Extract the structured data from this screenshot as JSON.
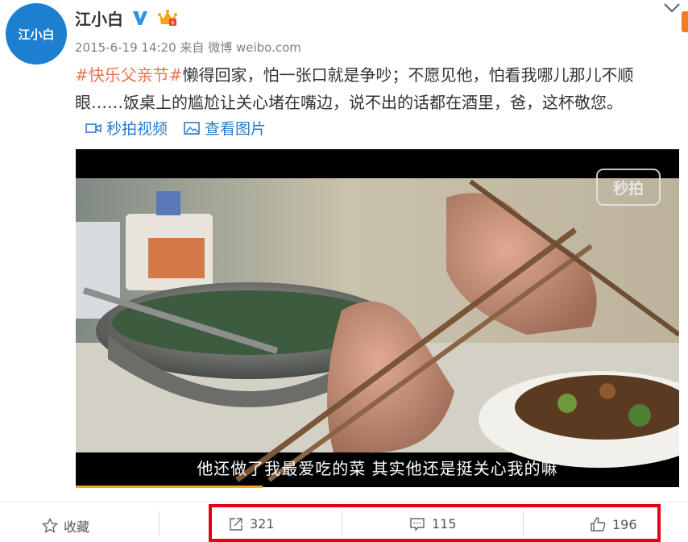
{
  "user": {
    "name": "江小白",
    "avatar_text": "江小白",
    "verified_icon": "verified-v-icon",
    "member_icon": "crown-icon"
  },
  "post": {
    "date": "2015-6-19 14:20",
    "source_prefix": "来自",
    "source": "微博 weibo.com",
    "hashtag": "#快乐父亲节#",
    "text": "懒得回家，怕一张口就是争吵；不愿见他，怕看我哪儿那儿不顺眼……饭桌上的尴尬让关心堵在嘴边，说不出的话都在酒里，爸，这杯敬您。"
  },
  "media_links": {
    "video_label": "秒拍视频",
    "image_label": "查看图片"
  },
  "video": {
    "subtitle": "他还做了我最爱吃的菜  其实他还是挺关心我的嘛",
    "watermark": "秒拍",
    "progress": 0.31
  },
  "actions": {
    "favorite_label": "收藏",
    "forward_count": "321",
    "comment_count": "115",
    "like_count": "196"
  },
  "colors": {
    "accent_link": "#2b7ccc",
    "hashtag": "#eb7350",
    "highlight_box": "#e60012",
    "avatar_bg": "#1d7fd0"
  }
}
